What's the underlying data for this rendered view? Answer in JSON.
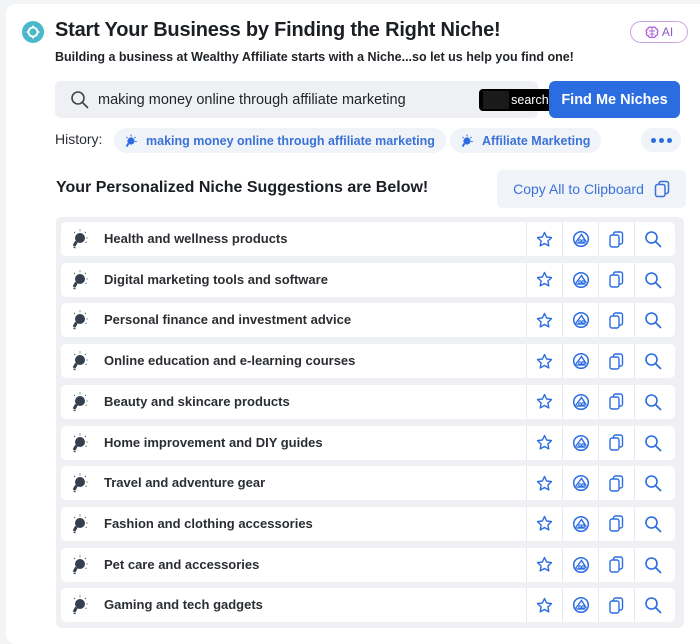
{
  "header": {
    "title": "Start Your Business by Finding the Right Niche!",
    "subtitle": "Building a business at Wealthy Affiliate starts with a Niche...so let us help you find one!",
    "ai_badge": "AI"
  },
  "search": {
    "value": "making money online through affiliate marketing",
    "placeholder": "",
    "searches_left_label": "searches left",
    "button_label": "Find Me Niches"
  },
  "history": {
    "label": "History:",
    "items": [
      {
        "label": "making money online through affiliate marketing"
      },
      {
        "label": "Affiliate Marketing"
      }
    ]
  },
  "results": {
    "title": "Your Personalized Niche Suggestions are Below!",
    "copy_all_label": "Copy All to Clipboard",
    "items": [
      {
        "label": "Health and wellness products"
      },
      {
        "label": "Digital marketing tools and software"
      },
      {
        "label": "Personal finance and investment advice"
      },
      {
        "label": "Online education and e-learning courses"
      },
      {
        "label": "Beauty and skincare products"
      },
      {
        "label": "Home improvement and DIY guides"
      },
      {
        "label": "Travel and adventure gear"
      },
      {
        "label": "Fashion and clothing accessories"
      },
      {
        "label": "Pet care and accessories"
      },
      {
        "label": "Gaming and tech gadgets"
      }
    ],
    "row_actions": [
      "star-icon",
      "analyze-icon",
      "copy-icon",
      "search-icon"
    ]
  },
  "colors": {
    "accent": "#2b6de1",
    "link": "#3a72d8",
    "teal": "#4bb8c9"
  }
}
